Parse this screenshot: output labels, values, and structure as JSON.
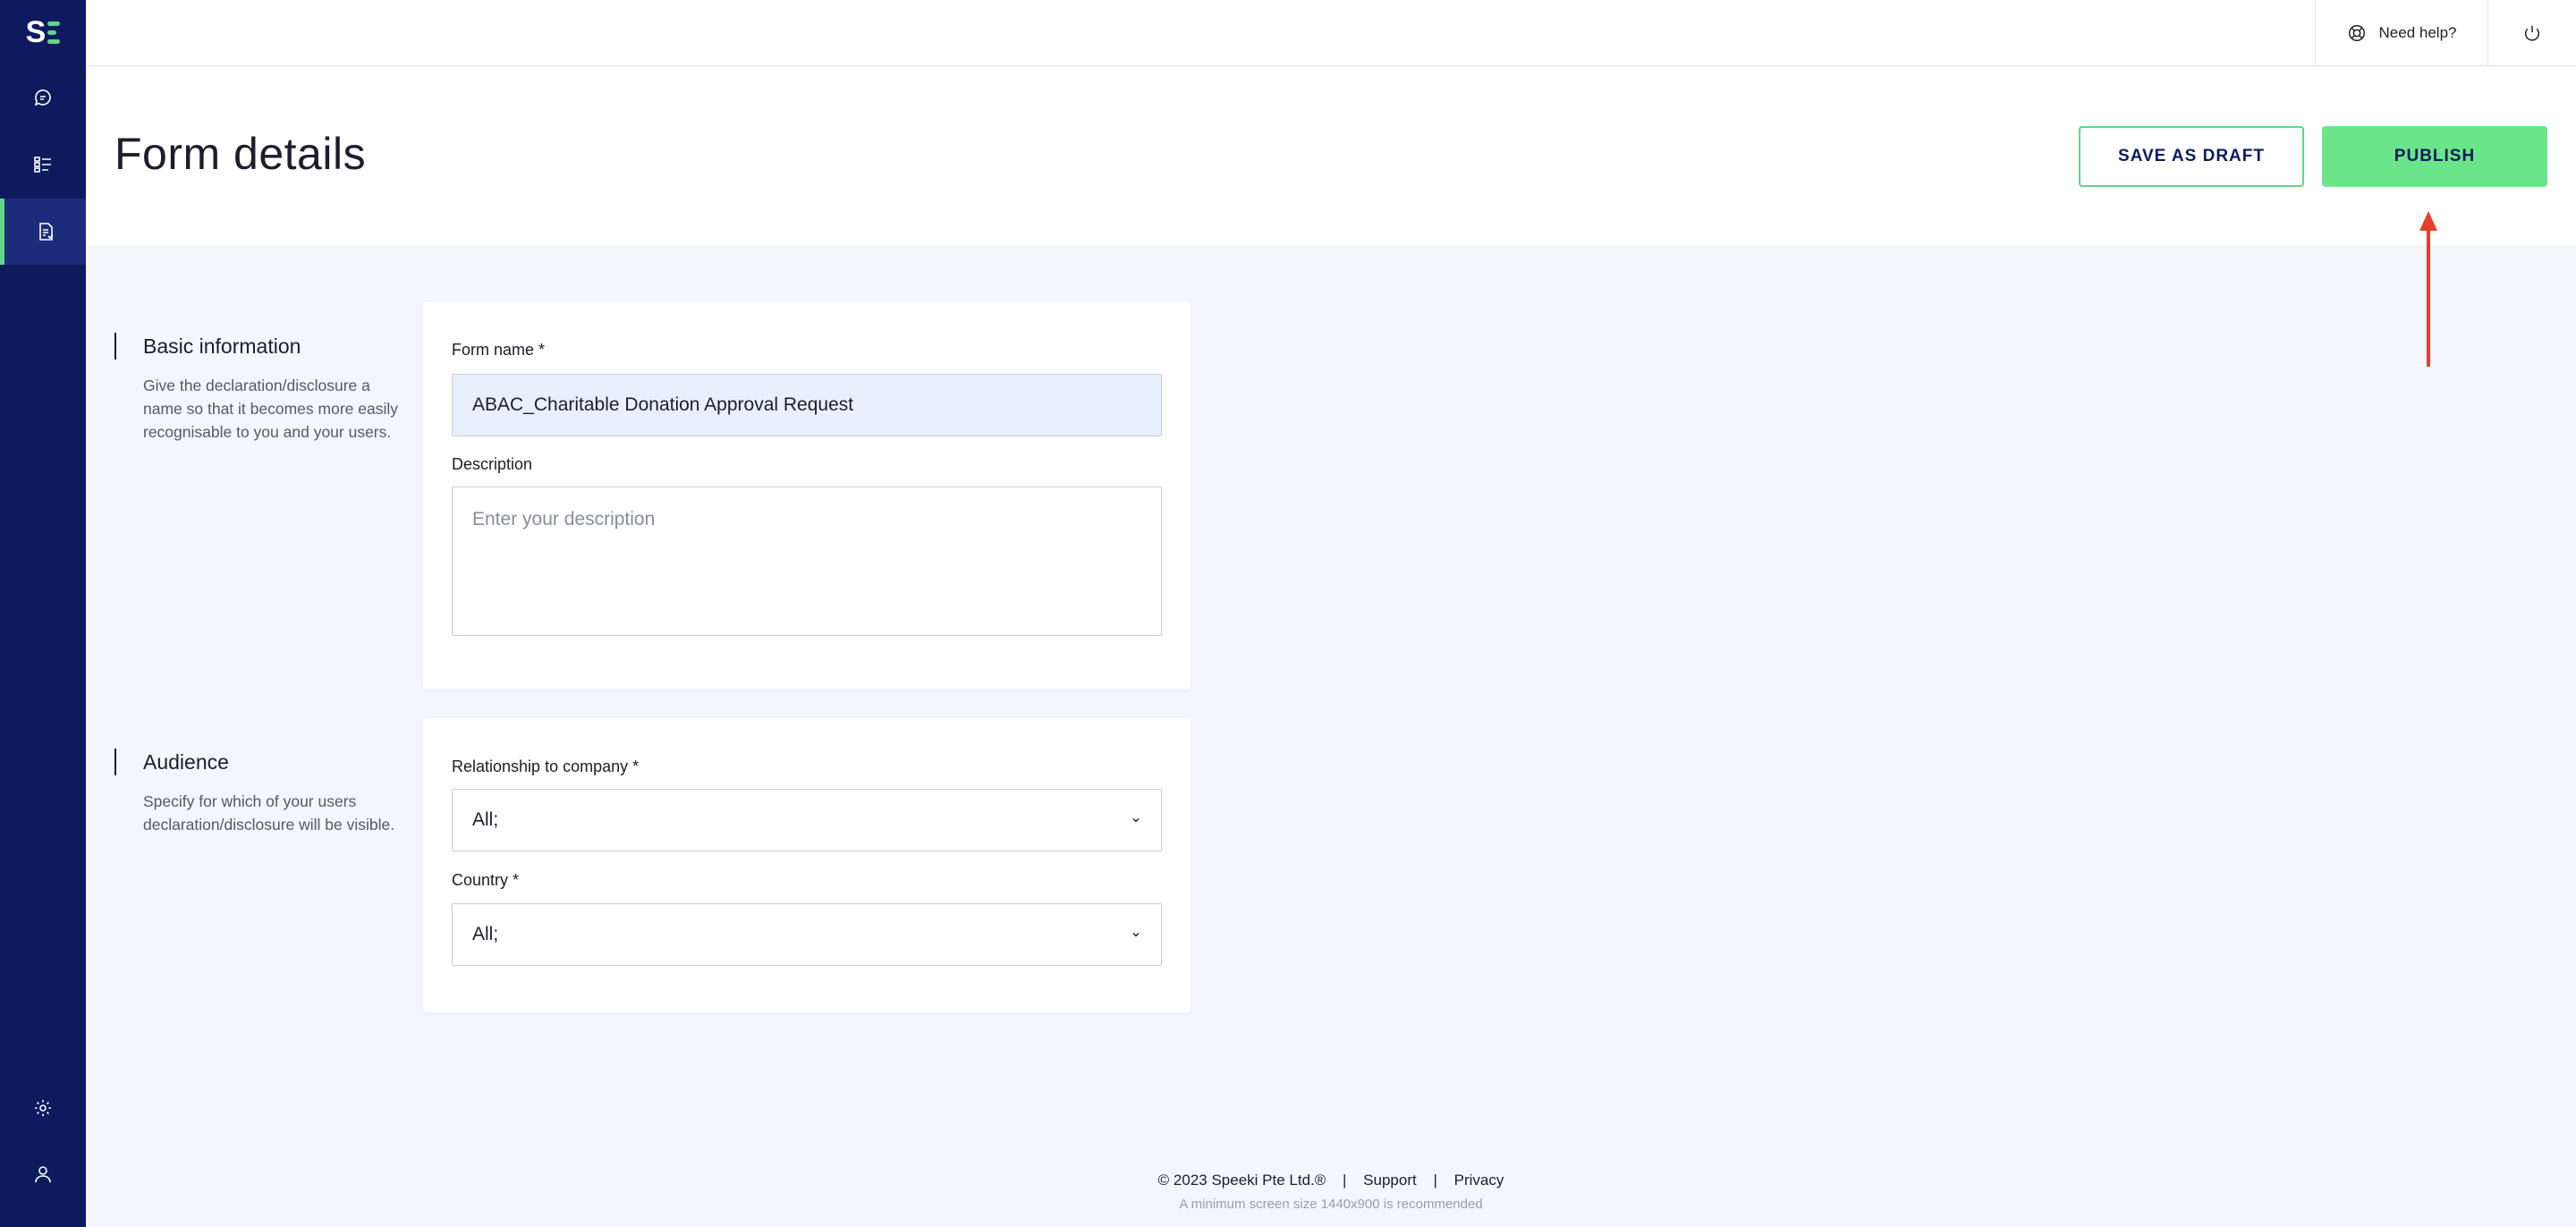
{
  "app": {
    "logo_text": "S"
  },
  "topbar": {
    "help_label": "Need help?"
  },
  "header": {
    "title": "Form details",
    "save_draft_label": "SAVE AS DRAFT",
    "publish_label": "PUBLISH"
  },
  "basic_info": {
    "heading": "Basic information",
    "description": "Give the declaration/disclosure a name so that it becomes more easily recognisable to you and your users.",
    "form_name_label": "Form name *",
    "form_name_value": "ABAC_Charitable Donation Approval Request",
    "description_label": "Description",
    "description_placeholder": "Enter your description"
  },
  "audience": {
    "heading": "Audience",
    "description": "Specify for which of your users declaration/disclosure will be visible.",
    "relationship_label": "Relationship to company *",
    "relationship_value": "All;",
    "country_label": "Country *",
    "country_value": "All;"
  },
  "footer": {
    "copyright": "© 2023 Speeki Pte Ltd.®",
    "support": "Support",
    "privacy": "Privacy",
    "separator": "|",
    "note": "A minimum screen size 1440x900 is recommended"
  },
  "colors": {
    "sidebar": "#0d1b5e",
    "accent": "#5fd68a",
    "publish": "#6be58a",
    "annotation_arrow": "#e5402a"
  }
}
